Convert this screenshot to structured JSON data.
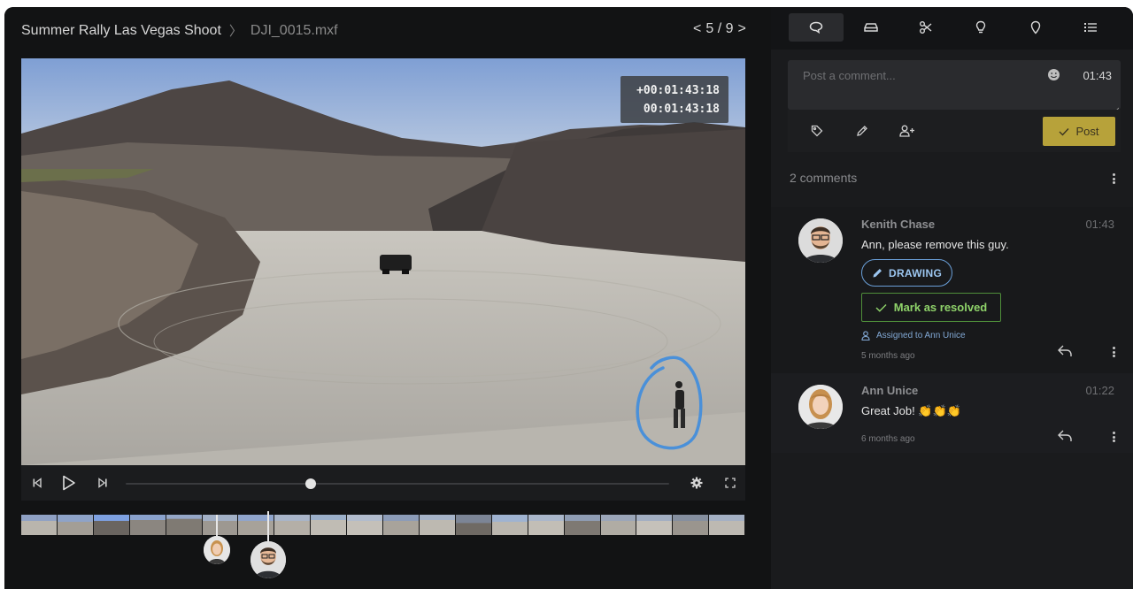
{
  "header": {
    "project_title": "Summer Rally Las Vegas Shoot",
    "separator": "〉",
    "file_name": "DJI_0015.mxf",
    "pager_prev": "<",
    "pager_text": "5 / 9",
    "pager_next": ">"
  },
  "player": {
    "timecode_offset": "+00:01:43:18",
    "timecode_absolute": "00:01:43:18",
    "playback_progress_fraction": 0.34,
    "controls": [
      "step-back-icon",
      "play-icon",
      "step-forward-icon",
      "settings-gear-icon",
      "fullscreen-icon"
    ]
  },
  "sidebar": {
    "tabs": [
      {
        "name": "comments-icon",
        "active": true
      },
      {
        "name": "car-icon",
        "active": false
      },
      {
        "name": "scissors-icon",
        "active": false
      },
      {
        "name": "lightbulb-icon",
        "active": false
      },
      {
        "name": "location-pin-icon",
        "active": false
      },
      {
        "name": "list-icon",
        "active": false
      }
    ],
    "composer": {
      "placeholder": "Post a comment...",
      "timestamp": "01:43",
      "post_label": "Post"
    },
    "comment_count": "2 comments",
    "comments": [
      {
        "author": "Kenith Chase",
        "time": "01:43",
        "text": "Ann, please remove this guy.",
        "drawing_label": "DRAWING",
        "resolve_label": "Mark as resolved",
        "assigned": "Assigned to Ann Unice",
        "ago": "5 months ago"
      },
      {
        "author": "Ann Unice",
        "time": "01:22",
        "text": "Great Job! 👏👏👏",
        "ago": "6 months ago"
      }
    ]
  },
  "colors": {
    "accent_post": "#b7a23a",
    "resolve_green": "#8fd36a",
    "drawing_blue": "#6a9fd8",
    "annotation_stroke": "#4a90d9"
  }
}
